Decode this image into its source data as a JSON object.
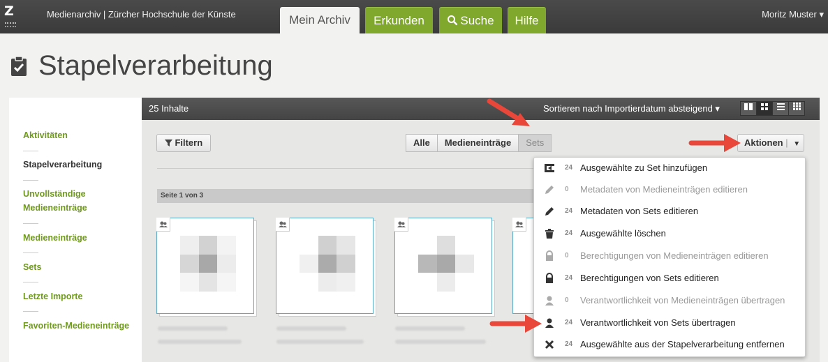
{
  "header": {
    "logo": "Z",
    "app_title": "Medienarchiv | Zürcher Hochschule der Künste",
    "tabs": [
      "Mein Archiv",
      "Erkunden",
      "Suche",
      "Hilfe"
    ],
    "user": "Moritz Muster ▾"
  },
  "page": {
    "title": "Stapelverarbeitung"
  },
  "sidebar": {
    "items": [
      "Aktivitäten",
      "Stapelverarbeitung",
      "Unvollständige Medieneinträge",
      "Medieneinträge",
      "Sets",
      "Letzte Importe",
      "Favoriten-Medieneinträge"
    ]
  },
  "toolbar": {
    "count": "25 Inhalte",
    "sort": "Sortieren nach Importierdatum absteigend ▾",
    "filter": "Filtern",
    "segments": [
      "Alle",
      "Medieneinträge",
      "Sets"
    ],
    "actions": "Aktionen"
  },
  "pagination": "Seite 1 von 3",
  "menu": [
    {
      "count": "24",
      "label": "Ausgewählte zu Set hinzufügen",
      "icon": "add-to-set-icon",
      "enabled": true
    },
    {
      "count": "0",
      "label": "Metadaten von Medieneinträgen editieren",
      "icon": "pencil-icon",
      "enabled": false
    },
    {
      "count": "24",
      "label": "Metadaten von Sets editieren",
      "icon": "pencil-icon",
      "enabled": true
    },
    {
      "count": "24",
      "label": "Ausgewählte löschen",
      "icon": "trash-icon",
      "enabled": true
    },
    {
      "count": "0",
      "label": "Berechtigungen von Medieneinträgen editieren",
      "icon": "lock-icon",
      "enabled": false
    },
    {
      "count": "24",
      "label": "Berechtigungen von Sets editieren",
      "icon": "lock-icon",
      "enabled": true
    },
    {
      "count": "0",
      "label": "Verantwortlichkeit von Medieneinträgen übertragen",
      "icon": "user-icon",
      "enabled": false
    },
    {
      "count": "24",
      "label": "Verantwortlichkeit von Sets übertragen",
      "icon": "user-icon",
      "enabled": true
    },
    {
      "count": "24",
      "label": "Ausgewählte aus der Stapelverarbeitung entfernen",
      "icon": "close-icon",
      "enabled": true
    }
  ],
  "colors": {
    "accent_green": "#7fa82c",
    "topbar": "#404040",
    "annotation_arrow": "#e8473a",
    "card_border": "#5ea9c3"
  }
}
